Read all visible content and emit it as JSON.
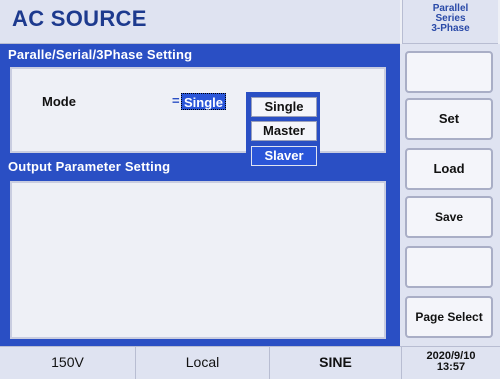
{
  "header": {
    "title": "AC SOURCE",
    "mode_indicator": [
      "Parallel",
      "Series",
      "3-Phase"
    ]
  },
  "parallel_section": {
    "title": "Paralle/Serial/3Phase  Setting",
    "mode_label": "Mode",
    "mode_equals": "=",
    "mode_value": "Single",
    "dropdown_options": [
      "Single",
      "Master",
      "Slaver"
    ],
    "dropdown_selected": "Slaver"
  },
  "output_section": {
    "title": "Output  Parameter  Setting"
  },
  "softkeys": [
    "",
    "Set",
    "Load",
    "Save",
    "",
    "Page Select"
  ],
  "status_bar": {
    "voltage": "150V",
    "control": "Local",
    "waveform": "SINE",
    "date": "2020/9/10",
    "time": "13:57"
  },
  "colors": {
    "panel_blue": "#2a4fc4",
    "highlight_blue": "#2a55d8",
    "title_blue": "#1d3a8e",
    "background": "#eef0f6"
  }
}
